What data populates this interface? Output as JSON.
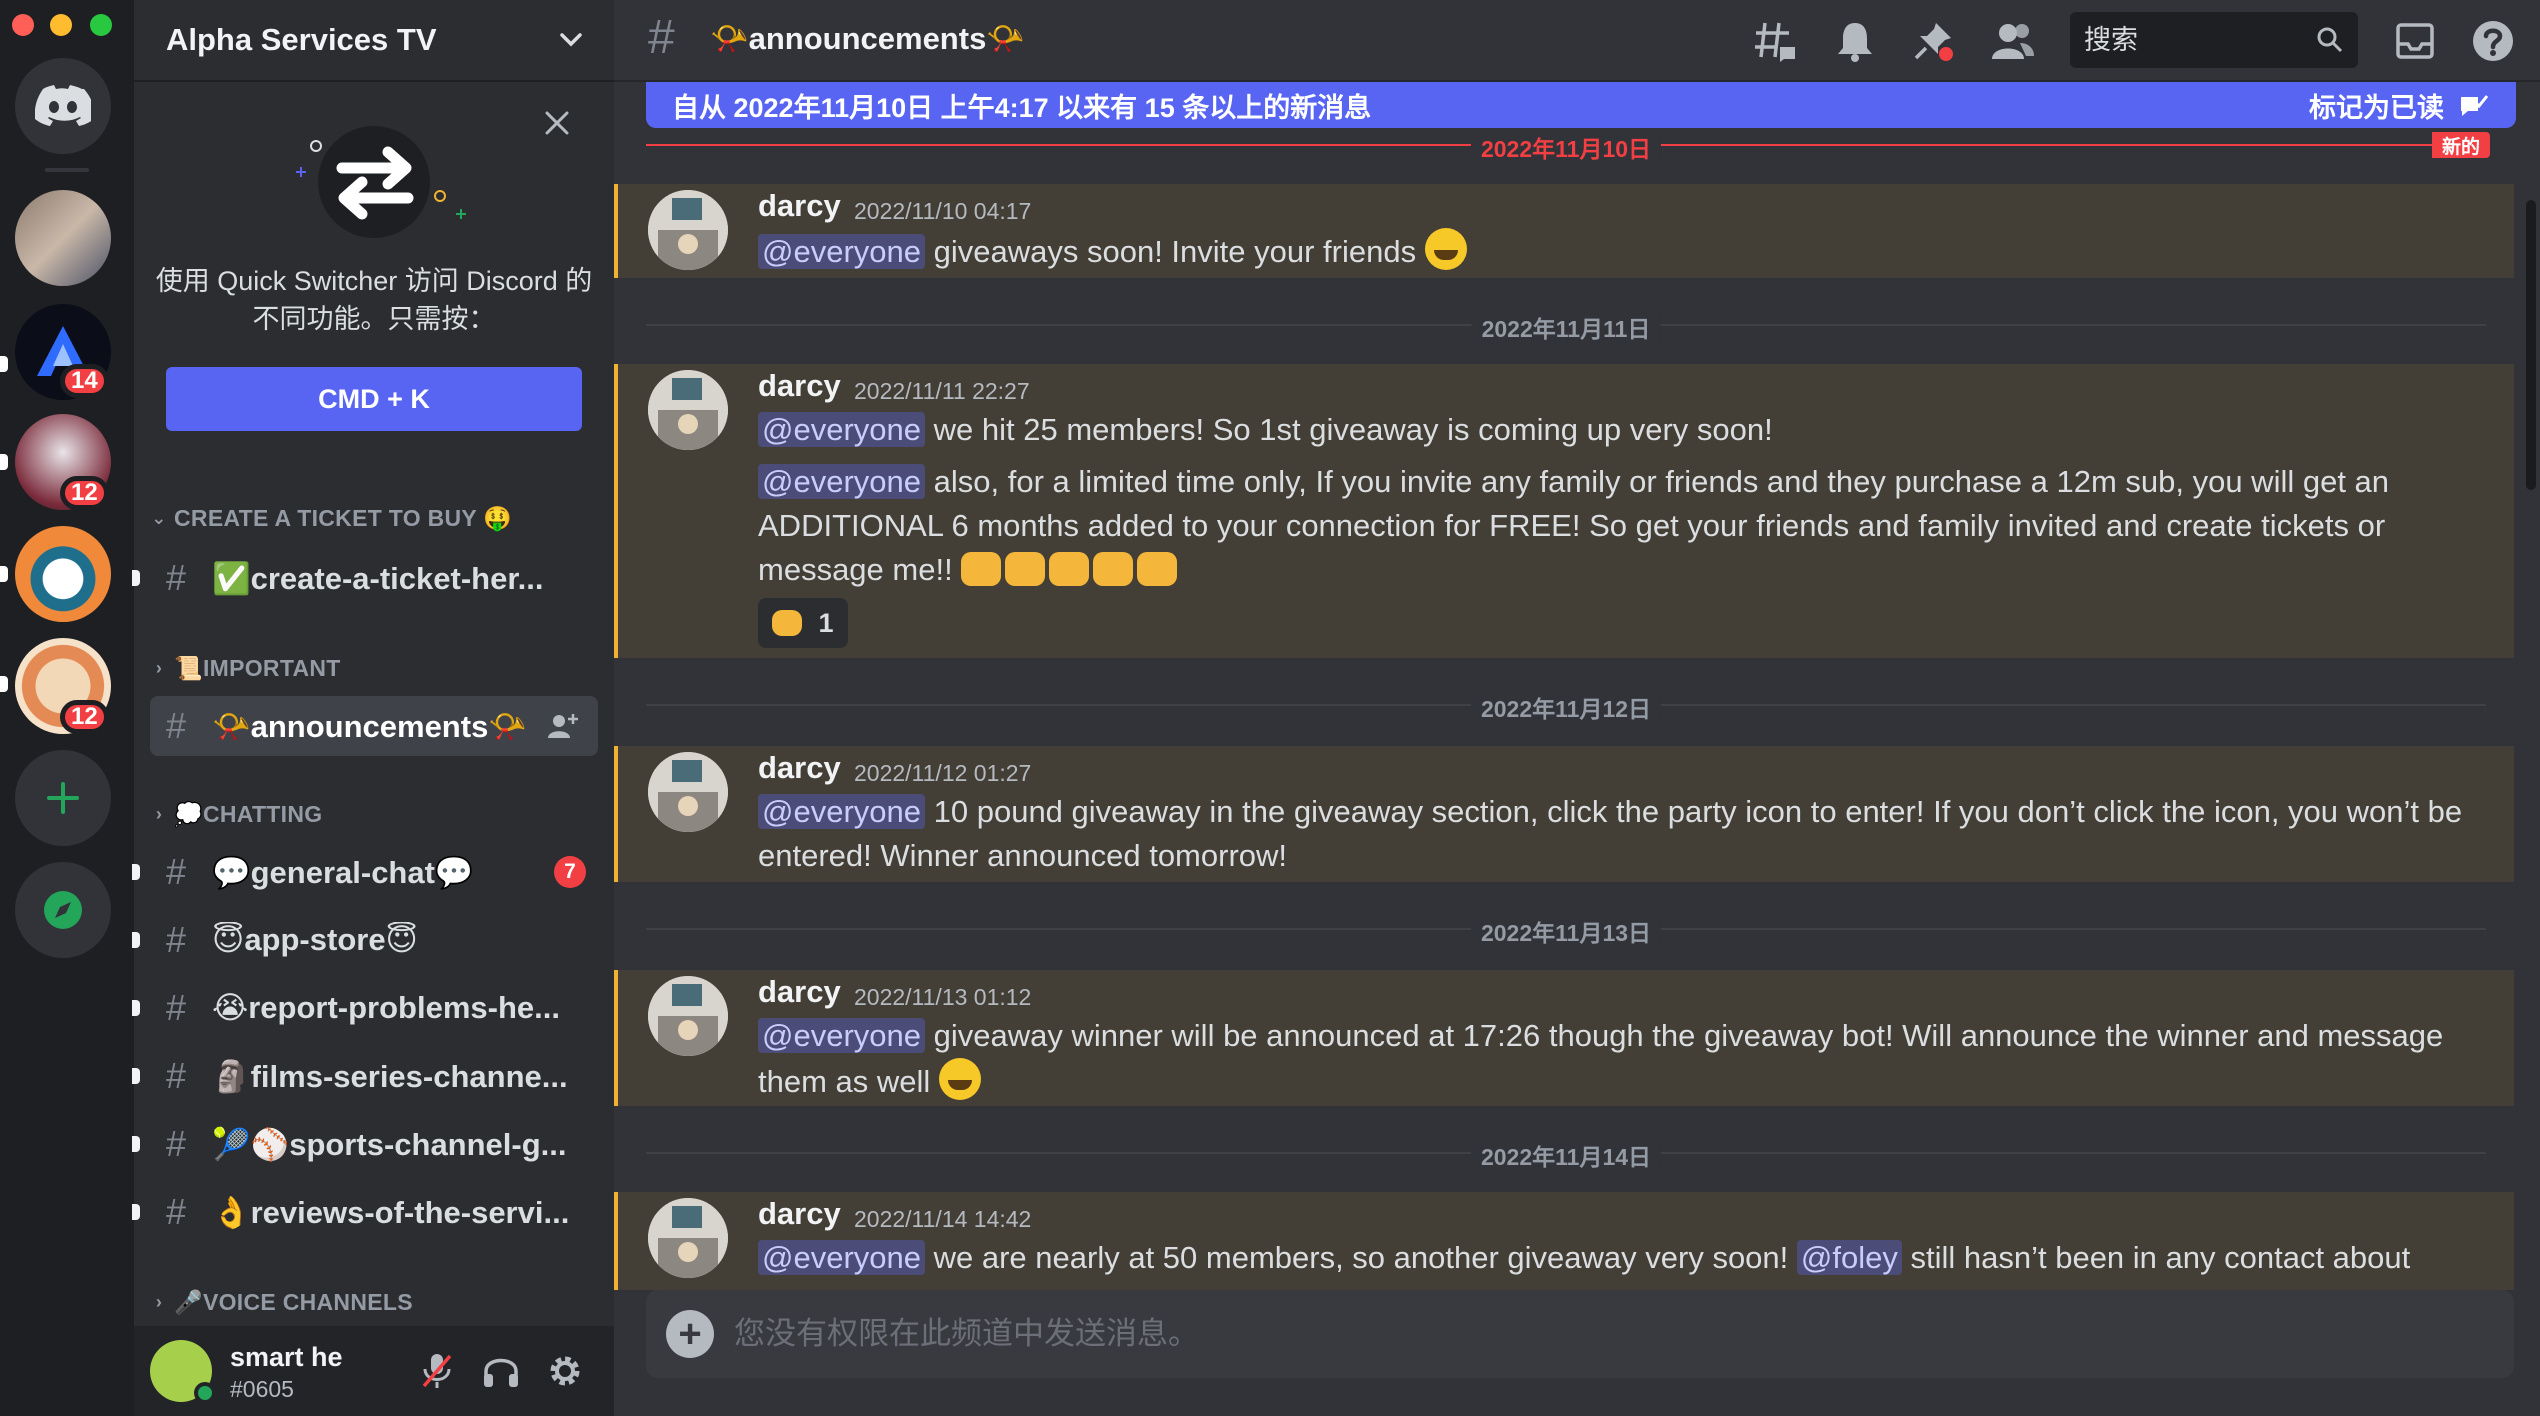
{
  "window": {
    "traffic_colors": [
      "#ff5f57",
      "#febc2e",
      "#28c840"
    ]
  },
  "servers": {
    "items": [
      {
        "name": "server-avatar-1",
        "badge": ""
      },
      {
        "name": "server-alpha",
        "badge": "14"
      },
      {
        "name": "server-anime",
        "badge": "12"
      },
      {
        "name": "server-mascot",
        "badge": ""
      },
      {
        "name": "server-emblem",
        "badge": "12"
      }
    ]
  },
  "sidebar": {
    "guild_name": "Alpha Services TV",
    "quick_switcher": {
      "text": "使用 Quick Switcher 访问 Discord 的不同功能。只需按：",
      "button": "CMD + K"
    },
    "categories": [
      {
        "label": "CREATE A TICKET TO BUY 🤑"
      },
      {
        "label": "📜IMPORTANT"
      },
      {
        "label": "💭CHATTING"
      },
      {
        "label": "🎤VOICE CHANNELS"
      }
    ],
    "channels": [
      {
        "label": "✅create-a-ticket-her...",
        "badge": ""
      },
      {
        "label": "📯announcements📯",
        "badge": ""
      },
      {
        "label": "💬general-chat💬",
        "badge": "7"
      },
      {
        "label": "😇app-store😇",
        "badge": ""
      },
      {
        "label": "😭report-problems-he...",
        "badge": ""
      },
      {
        "label": "🗿films-series-channe...",
        "badge": ""
      },
      {
        "label": "🎾⚾sports-channel-g...",
        "badge": ""
      },
      {
        "label": "👌reviews-of-the-servi...",
        "badge": ""
      }
    ],
    "user": {
      "name": "smart he",
      "tag": "#0605"
    }
  },
  "header": {
    "channel_title": "📯announcements📯",
    "search_placeholder": "搜索"
  },
  "banner": {
    "text": "自从 2022年11月10日 上午4:17 以来有 15 条以上的新消息",
    "mark_read": "标记为已读"
  },
  "dates": {
    "d1": "2022年11月10日",
    "d2": "2022年11月11日",
    "d3": "2022年11月12日",
    "d4": "2022年11月13日",
    "d5": "2022年11月14日",
    "new_tag": "新的"
  },
  "messages": [
    {
      "author": "darcy",
      "timestamp": "2022/11/10 04:17",
      "mention": "@everyone",
      "text": "giveaways soon! Invite your friends"
    },
    {
      "author": "darcy",
      "timestamp": "2022/11/11 22:27",
      "mention": "@everyone",
      "text": "we hit 25 members! So 1st giveaway is coming up very soon!",
      "mention2": "@everyone",
      "text2": "also, for a limited time only, If you invite any family or friends and they purchase a 12m sub, you will get an ADDITIONAL 6 months added to your connection for FREE! So get your friends and family invited and create tickets or message me!!",
      "reaction_count": "1"
    },
    {
      "author": "darcy",
      "timestamp": "2022/11/12 01:27",
      "mention": "@everyone",
      "text": "10 pound giveaway in the giveaway section, click the party icon to enter! If you don’t click the icon, you won’t be entered! Winner announced tomorrow!"
    },
    {
      "author": "darcy",
      "timestamp": "2022/11/13 01:12",
      "mention": "@everyone",
      "text": "giveaway winner will be announced at 17:26 though  the giveaway bot! Will announce the winner and message them as well"
    },
    {
      "author": "darcy",
      "timestamp": "2022/11/14 14:42",
      "mention": "@everyone",
      "text": "we are nearly at 50 members, so another giveaway very soon!",
      "mention2": "@foley",
      "text2": "still hasn’t been in any contact about"
    }
  ],
  "composer": {
    "placeholder": "您没有权限在此频道中发送消息。"
  },
  "colors": {
    "accent": "#5865f2",
    "highlight": "#f0b232",
    "danger": "#f23f43"
  }
}
